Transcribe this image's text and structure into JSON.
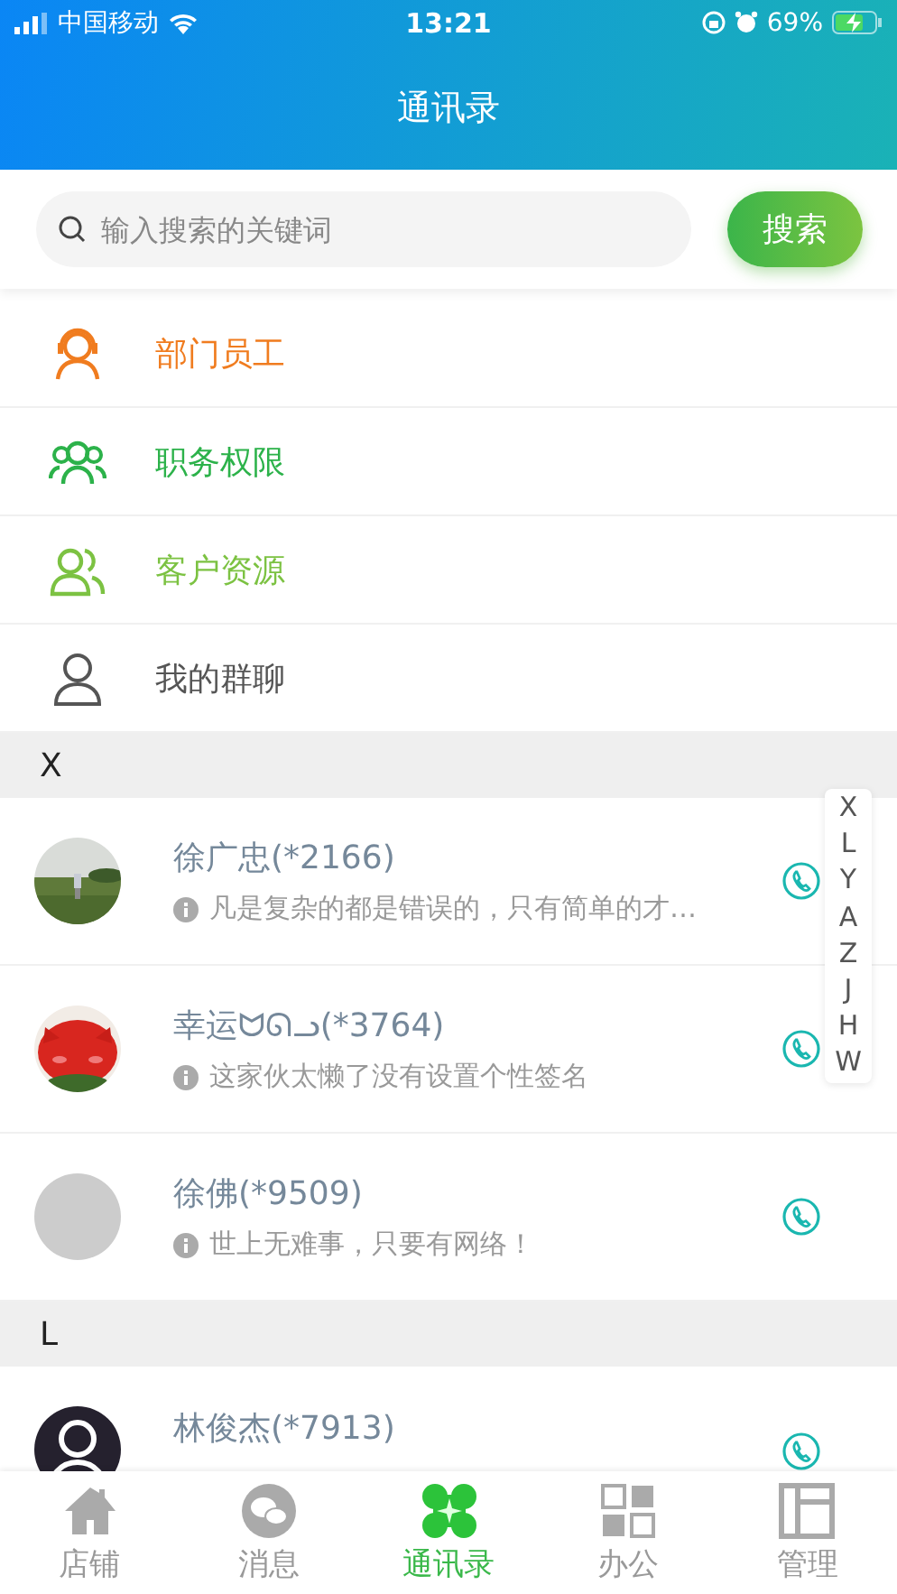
{
  "status_bar": {
    "carrier": "中国移动",
    "time": "13:21",
    "battery": "69%"
  },
  "header": {
    "title": "通讯录"
  },
  "search": {
    "placeholder": "输入搜索的关键词",
    "button": "搜索"
  },
  "menu": [
    {
      "label": "部门员工",
      "kind": "department",
      "color": "#f07c1f"
    },
    {
      "label": "职务权限",
      "kind": "roles",
      "color": "#2cb24a"
    },
    {
      "label": "客户资源",
      "kind": "customers",
      "color": "#7cc242"
    },
    {
      "label": "我的群聊",
      "kind": "groups",
      "color": "#555555"
    }
  ],
  "sections": [
    {
      "letter": "X",
      "contacts": [
        {
          "name": "徐广忠(*2166)",
          "signature": "凡是复杂的都是错误的，只有简单的才…",
          "kind": "picture"
        },
        {
          "name": "幸运ᗢᘏᓗ(*3764)",
          "signature": "这家伙太懒了没有设置个性签名",
          "kind": "picture"
        },
        {
          "name": "徐佛(*9509)",
          "signature": "世上无难事，只要有网络！",
          "kind": "blank"
        }
      ]
    },
    {
      "letter": "L",
      "contacts": [
        {
          "name": "林俊杰(*7913)",
          "kind": "silhouette"
        }
      ]
    }
  ],
  "index_bar": [
    "X",
    "L",
    "Y",
    "A",
    "Z",
    "J",
    "H",
    "W"
  ],
  "tabs": [
    {
      "label": "店铺",
      "kind": "home",
      "selected": false
    },
    {
      "label": "消息",
      "kind": "chat",
      "selected": false
    },
    {
      "label": "通讯录",
      "kind": "contacts",
      "selected": true
    },
    {
      "label": "办公",
      "kind": "grid",
      "selected": false
    },
    {
      "label": "管理",
      "kind": "layout",
      "selected": false
    }
  ]
}
